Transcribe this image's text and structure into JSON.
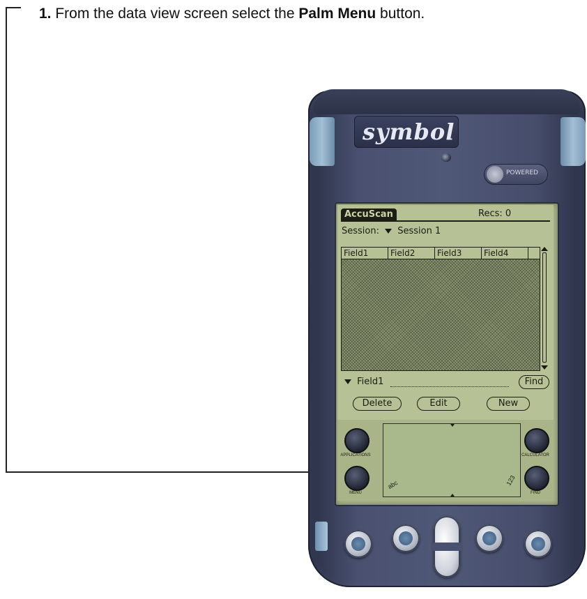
{
  "instruction": {
    "step_number": "1.",
    "text_before": " From the data view screen select the ",
    "bold_term": "Palm Menu",
    "text_after": " button."
  },
  "device": {
    "brand": "symbol",
    "badge_text": "POWERED"
  },
  "app": {
    "title": "AccuScan",
    "recs_label": "Recs: 0",
    "session_label": "Session:",
    "session_value": "Session 1",
    "columns": [
      "Field1",
      "Field2",
      "Field3",
      "Field4"
    ],
    "field_select": "Field1",
    "find_button": "Find",
    "delete_button": "Delete",
    "edit_button": "Edit",
    "new_button": "New"
  },
  "silkscreen": {
    "applications": "APPLICATIONS",
    "menu": "MENU",
    "calculator": "CALCULATOR",
    "find": "FIND",
    "graffiti_left": "abc",
    "graffiti_right": "123"
  },
  "colors": {
    "lcd": "#b6c196",
    "device_body": "#4a5170",
    "callout": "#222222"
  }
}
